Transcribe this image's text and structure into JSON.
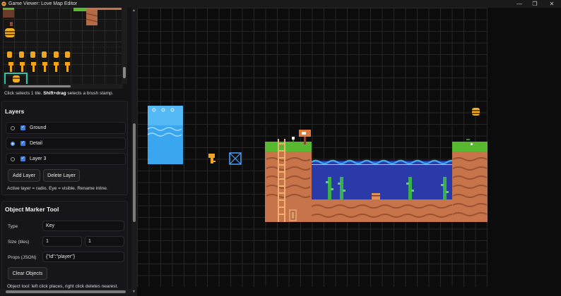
{
  "window": {
    "title": "Game Viewer: Love Map Editor",
    "controls": {
      "minimize": "—",
      "maximize": "❒",
      "close": "✕"
    }
  },
  "tileset": {
    "hint_prefix": "Click selects 1 tile. ",
    "hint_bold": "Shift+drag",
    "hint_suffix": " selects a brush stamp."
  },
  "layers": {
    "title": "Layers",
    "items": [
      {
        "name": "Ground",
        "active": false,
        "visible": true
      },
      {
        "name": "Detail",
        "active": true,
        "visible": true
      },
      {
        "name": "Layer 3",
        "active": false,
        "visible": true
      }
    ],
    "add_label": "Add Layer",
    "delete_label": "Delete Layer",
    "note": "Active layer = radio. Eye = visible. Rename inline."
  },
  "object_tool": {
    "title": "Object Marker Tool",
    "type_label": "Type",
    "type_value": "Key",
    "size_label": "Size (tiles)",
    "size_w": "1",
    "size_h": "1",
    "props_label": "Props (JSON)",
    "props_value": "{\"id\":\"player\"}",
    "clear_label": "Clear Objects",
    "note": "Object tool: left click places, right click deletes nearest."
  },
  "colors": {
    "accent": "#3a7bdc",
    "selection": "#2ec4a6",
    "grass": "#58b830",
    "dirt": "#c8744a",
    "water": "#2a3aa8",
    "waterfall": "#3aa6f0"
  },
  "icons": {
    "app": "game-controller-icon",
    "key": "key-icon",
    "chest": "treasure-chest-icon",
    "bee": "beehive-icon",
    "sign": "signpost-icon",
    "ladder": "ladder-icon",
    "door": "door-icon",
    "marker": "object-marker-icon"
  }
}
